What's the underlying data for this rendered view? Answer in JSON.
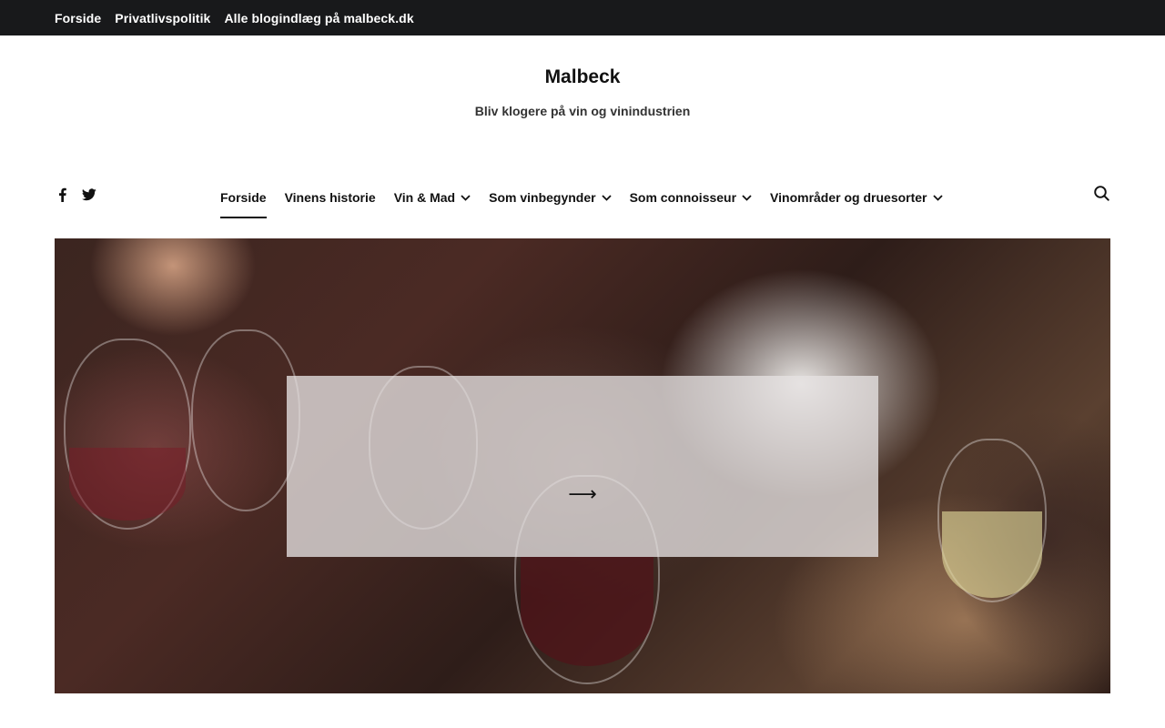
{
  "topbar": {
    "links": [
      "Forside",
      "Privatlivspolitik",
      "Alle blogindlæg på malbeck.dk"
    ]
  },
  "site": {
    "title": "Malbeck",
    "tagline": "Bliv klogere på vin og vinindustrien"
  },
  "social": {
    "icons": [
      "facebook-icon",
      "twitter-icon"
    ]
  },
  "nav": {
    "items": [
      {
        "label": "Forside",
        "active": true,
        "dropdown": false
      },
      {
        "label": "Vinens historie",
        "active": false,
        "dropdown": false
      },
      {
        "label": "Vin & Mad",
        "active": false,
        "dropdown": true
      },
      {
        "label": "Som vinbegynder",
        "active": false,
        "dropdown": true
      },
      {
        "label": "Som connoisseur",
        "active": false,
        "dropdown": true
      },
      {
        "label": "Vinområder og druesorter",
        "active": false,
        "dropdown": true
      }
    ],
    "search_icon": "search-icon"
  },
  "hero": {
    "arrow": "⟶",
    "image_alt": ""
  },
  "colors": {
    "topbar_bg": "#18191b",
    "text": "#111111",
    "overlay": "rgba(230,226,226,0.78)"
  }
}
